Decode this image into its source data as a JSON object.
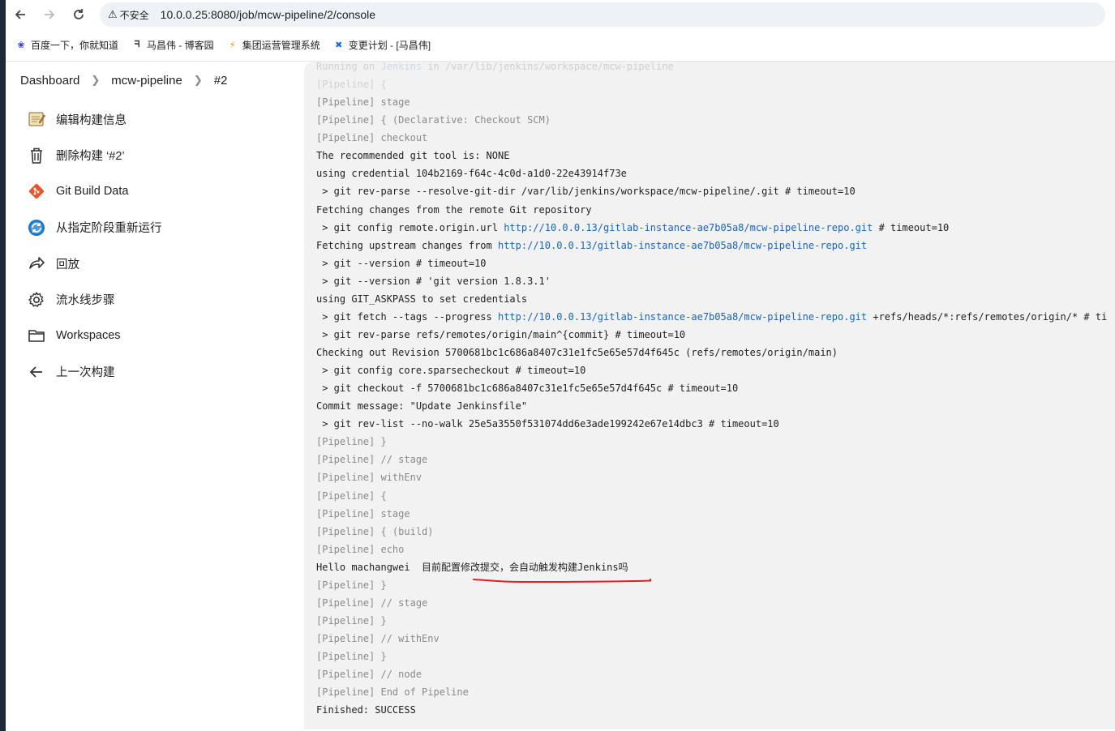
{
  "browser": {
    "insecure_label": "不安全",
    "url": "10.0.0.25:8080/job/mcw-pipeline/2/console",
    "bookmarks": [
      {
        "label": "百度一下，你就知道",
        "icon": "baidu-icon"
      },
      {
        "label": "马昌伟 - 博客园",
        "icon": "cnblogs-icon"
      },
      {
        "label": "集团运营管理系统",
        "icon": "system-icon"
      },
      {
        "label": "变更计划 - [马昌伟]",
        "icon": "confluence-icon"
      }
    ]
  },
  "breadcrumb": {
    "items": [
      "Dashboard",
      "mcw-pipeline",
      "#2"
    ]
  },
  "sidebar": {
    "items": [
      {
        "label": "编辑构建信息",
        "icon": "notepad-icon"
      },
      {
        "label": "删除构建 ‘#2’",
        "icon": "trash-icon"
      },
      {
        "label": "Git Build Data",
        "icon": "git-icon"
      },
      {
        "label": "从指定阶段重新运行",
        "icon": "restart-icon"
      },
      {
        "label": "回放",
        "icon": "replay-icon"
      },
      {
        "label": "流水线步骤",
        "icon": "gear-icon"
      },
      {
        "label": "Workspaces",
        "icon": "folder-icon"
      },
      {
        "label": "上一次构建",
        "icon": "arrow-left-icon"
      }
    ]
  },
  "console": {
    "line_running_prefix": "Running on ",
    "line_running_link": "Jenkins",
    "line_running_suffix": " in /var/lib/jenkins/workspace/mcw-pipeline",
    "line_hidden": "[Pipeline] {",
    "line_01": "[Pipeline] stage",
    "line_02": "[Pipeline] { (Declarative: Checkout SCM)",
    "line_03": "[Pipeline] checkout",
    "line_04": "The recommended git tool is: NONE",
    "line_05": "using credential 104b2169-f64c-4c0d-a1d0-22e43914f73e",
    "line_06": " > git rev-parse --resolve-git-dir /var/lib/jenkins/workspace/mcw-pipeline/.git # timeout=10",
    "line_07": "Fetching changes from the remote Git repository",
    "line_08_prefix": " > git config remote.origin.url ",
    "repo_url": "http://10.0.0.13/gitlab-instance-ae7b05a8/mcw-pipeline-repo.git",
    "line_08_suffix": " # timeout=10",
    "line_09_prefix": "Fetching upstream changes from ",
    "line_10": " > git --version # timeout=10",
    "line_11": " > git --version # 'git version 1.8.3.1'",
    "line_12": "using GIT_ASKPASS to set credentials",
    "line_13_prefix": " > git fetch --tags --progress ",
    "line_13_suffix": " +refs/heads/*:refs/remotes/origin/* # ti",
    "line_14": " > git rev-parse refs/remotes/origin/main^{commit} # timeout=10",
    "line_15": "Checking out Revision 5700681bc1c686a8407c31e1fc5e65e57d4f645c (refs/remotes/origin/main)",
    "line_16": " > git config core.sparsecheckout # timeout=10",
    "line_17": " > git checkout -f 5700681bc1c686a8407c31e1fc5e65e57d4f645c # timeout=10",
    "line_18": "Commit message: \"Update Jenkinsfile\"",
    "line_19": " > git rev-list --no-walk 25e5a3550f531074dd6e3ade199242e67e14dbc3 # timeout=10",
    "line_20": "[Pipeline] }",
    "line_21": "[Pipeline] // stage",
    "line_22": "[Pipeline] withEnv",
    "line_23": "[Pipeline] {",
    "line_24": "[Pipeline] stage",
    "line_25": "[Pipeline] { (build)",
    "line_26": "[Pipeline] echo",
    "line_27": "Hello machangwei  目前配置修改提交，会自动触发构建Jenkins吗",
    "line_28": "[Pipeline] }",
    "line_29": "[Pipeline] // stage",
    "line_30": "[Pipeline] }",
    "line_31": "[Pipeline] // withEnv",
    "line_32": "[Pipeline] }",
    "line_33": "[Pipeline] // node",
    "line_34": "[Pipeline] End of Pipeline",
    "line_35": "Finished: SUCCESS"
  },
  "colors": {
    "link": "#1565c0",
    "annotation_underline": "#e02020",
    "console_bg": "#f2f2f3"
  }
}
